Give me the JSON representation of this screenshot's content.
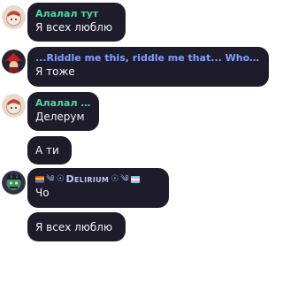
{
  "messages": [
    {
      "author": "Алалал тут",
      "text": "Я всех люблю",
      "name_color": "#4fd6a0"
    },
    {
      "author": "...Riddle me this, riddle me that... Who's af...",
      "text": "Я тоже",
      "name_color": "#7fa0ff"
    },
    {
      "author": "Алалал тут",
      "text": "Делерум",
      "name_color": "#4fd6a0"
    },
    {
      "author": "",
      "text": "А ти"
    },
    {
      "author": "Delirium",
      "text": "Чо"
    },
    {
      "author": "",
      "text": "Я всех люблю"
    }
  ],
  "colors": {
    "bubble": "#1e1c2a",
    "text": "#f1f1f4"
  }
}
